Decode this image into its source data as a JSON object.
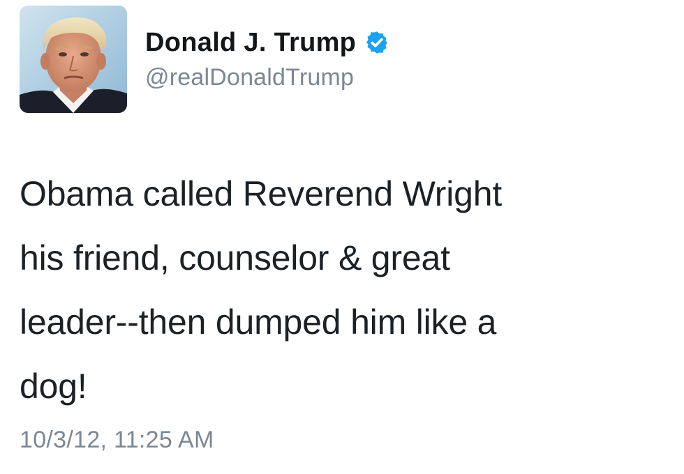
{
  "tweet": {
    "author": {
      "display_name": "Donald J. Trump",
      "handle": "@realDonaldTrump",
      "verified": true,
      "avatar_icon": "profile-photo",
      "verified_icon": "verified-badge-icon"
    },
    "text": "Obama called Reverend Wright\nhis friend, counselor & great\nleader--then dumped him like a\ndog!",
    "timestamp": "10/3/12, 11:25 AM"
  },
  "colors": {
    "text": "#1c2126",
    "secondary_text": "#7a8893",
    "verified_blue": "#1da1f2",
    "background": "#ffffff"
  }
}
